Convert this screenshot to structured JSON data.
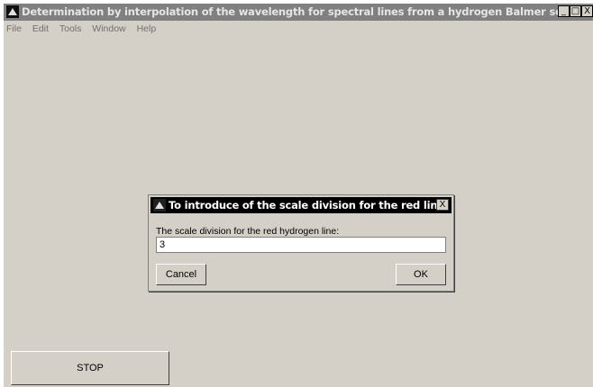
{
  "window": {
    "title": "Determination by interpolation of the wavelength for spectral lines from a hydrogen Balmer serie",
    "minimize": "_",
    "maximize": "□",
    "close": "X"
  },
  "menubar": {
    "items": [
      "File",
      "Edit",
      "Tools",
      "Window",
      "Help"
    ]
  },
  "dialog": {
    "title": "To introduce of the scale division for the red line",
    "close": "X",
    "prompt": "The scale division for the red hydrogen line:",
    "input_value": "3",
    "cancel_label": "Cancel",
    "ok_label": "OK"
  },
  "stop_label": "STOP",
  "colors": {
    "background": "#d4d0c8",
    "titlebar_inactive": "#808080",
    "dialog_titlebar": "#000000"
  }
}
